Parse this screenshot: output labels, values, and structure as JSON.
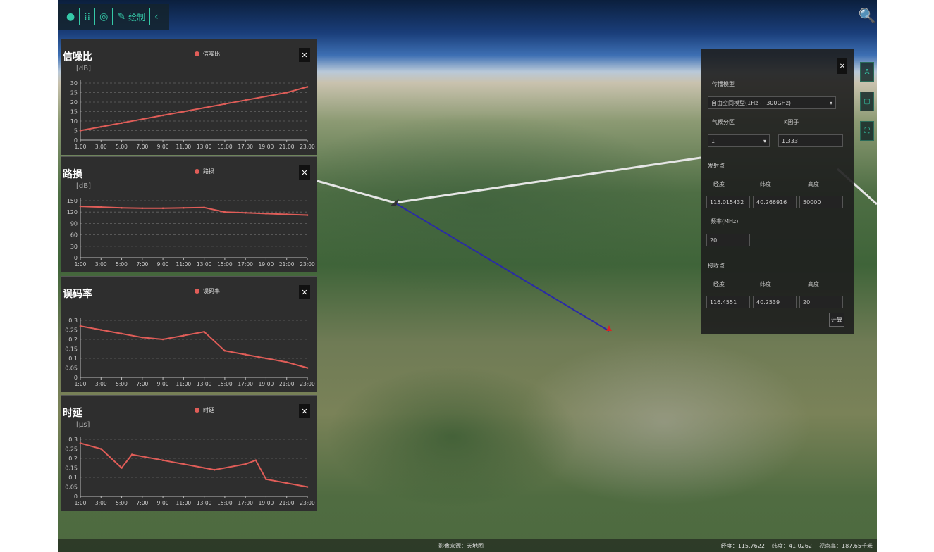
{
  "toolbar": {
    "items": [
      {
        "icon": "globe-icon",
        "glyph": "●"
      },
      {
        "icon": "grid-icon",
        "glyph": "⁞⁞"
      },
      {
        "icon": "layers-icon",
        "glyph": "◎"
      },
      {
        "icon": "pencil-icon",
        "glyph": "✎",
        "label": "绘制"
      },
      {
        "icon": "chevron-left-icon",
        "glyph": "‹"
      }
    ],
    "accent": "#35c9a8"
  },
  "search_glyph": "🔍",
  "x_ticks": [
    "1:00",
    "3:00",
    "5:00",
    "7:00",
    "9:00",
    "11:00",
    "13:00",
    "15:00",
    "17:00",
    "19:00",
    "21:00",
    "23:00"
  ],
  "chart_data": [
    {
      "type": "line",
      "title": "信噪比",
      "ylabel": "[dB]",
      "legend": "信噪比",
      "x": [
        "1:00",
        "3:00",
        "5:00",
        "7:00",
        "9:00",
        "11:00",
        "13:00",
        "15:00",
        "17:00",
        "19:00",
        "21:00",
        "23:00"
      ],
      "series": [
        {
          "name": "信噪比",
          "values": [
            5,
            7,
            9,
            11,
            13,
            15,
            17,
            19,
            21,
            23,
            25,
            28
          ]
        }
      ],
      "yticks": [
        0,
        5,
        10,
        15,
        20,
        25,
        30
      ],
      "ylim": [
        0,
        30
      ],
      "color": "#e05d58"
    },
    {
      "type": "line",
      "title": "路损",
      "ylabel": "[dB]",
      "legend": "路损",
      "x": [
        "1:00",
        "3:00",
        "5:00",
        "7:00",
        "9:00",
        "11:00",
        "13:00",
        "15:00",
        "17:00",
        "19:00",
        "21:00",
        "23:00"
      ],
      "series": [
        {
          "name": "路损",
          "values": [
            135,
            133,
            131,
            130,
            130,
            131,
            132,
            120,
            118,
            116,
            114,
            112
          ]
        }
      ],
      "yticks": [
        0,
        30,
        60,
        90,
        120,
        150
      ],
      "ylim": [
        0,
        150
      ],
      "color": "#e05d58"
    },
    {
      "type": "line",
      "title": "误码率",
      "ylabel": "",
      "legend": "误码率",
      "x": [
        "1:00",
        "3:00",
        "5:00",
        "7:00",
        "9:00",
        "11:00",
        "13:00",
        "15:00",
        "17:00",
        "19:00",
        "21:00",
        "23:00"
      ],
      "series": [
        {
          "name": "误码率",
          "values": [
            0.27,
            0.25,
            0.23,
            0.21,
            0.2,
            0.22,
            0.24,
            0.14,
            0.12,
            0.1,
            0.08,
            0.05
          ]
        }
      ],
      "yticks": [
        0,
        0.05,
        0.1,
        0.15,
        0.2,
        0.25,
        0.3
      ],
      "ylim": [
        0,
        0.3
      ],
      "color": "#e05d58"
    },
    {
      "type": "line",
      "title": "时延",
      "ylabel": "[μs]",
      "legend": "时延",
      "x": [
        "1:00",
        "3:00",
        "5:00",
        "6:00",
        "7:00",
        "9:00",
        "11:00",
        "13:00",
        "14:00",
        "17:00",
        "18:00",
        "19:00",
        "21:00",
        "23:00"
      ],
      "series": [
        {
          "name": "时延",
          "values": [
            0.28,
            0.25,
            0.15,
            0.22,
            0.21,
            0.19,
            0.17,
            0.15,
            0.14,
            0.17,
            0.19,
            0.09,
            0.07,
            0.05
          ]
        }
      ],
      "yticks": [
        0,
        0.05,
        0.1,
        0.15,
        0.2,
        0.25,
        0.3
      ],
      "ylim": [
        0,
        0.3
      ],
      "color": "#e05d58"
    }
  ],
  "form": {
    "model_label": "传播模型",
    "model_value": "自由空间模型(1Hz ~ 300GHz)",
    "region_label": "气候分区",
    "region_value": "1",
    "k_label": "K因子",
    "k_value": "1.333",
    "transmit_label": "发射点",
    "lon_label": "经度",
    "lat_label": "纬度",
    "alt_label": "高度",
    "tx_lon": "115.015432",
    "tx_lat": "40.266916",
    "tx_alt": "50000",
    "freq_label": "频率(MHz)",
    "freq_value": "20",
    "receive_label": "接收点",
    "rx_lon": "116.4551",
    "rx_lat": "40.2539",
    "rx_alt": "20",
    "calc_button": "计算"
  },
  "side_buttons": [
    {
      "icon": "text-icon",
      "glyph": "A"
    },
    {
      "icon": "square-icon",
      "glyph": "▢"
    },
    {
      "icon": "fullscreen-icon",
      "glyph": "⛶"
    }
  ],
  "status": {
    "center": "影像来源：天地图",
    "lon": "经度：115.7622",
    "lat": "纬度：41.0262",
    "height": "视点高：187.65千米"
  }
}
